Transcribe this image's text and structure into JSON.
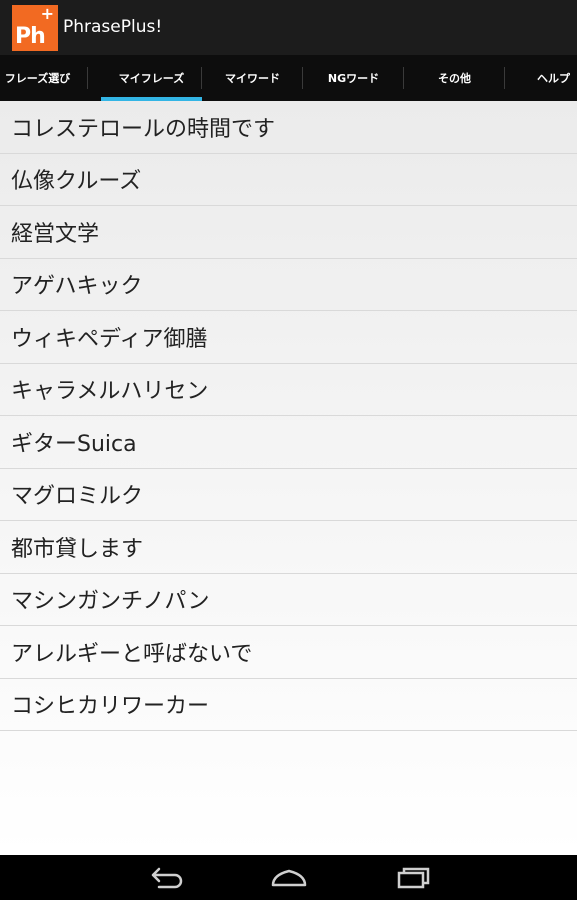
{
  "app": {
    "title": "PhrasePlus!",
    "icon_text": "Ph",
    "icon_plus": "+"
  },
  "colors": {
    "accent": "#33b5e5",
    "icon_bg": "#f26a22"
  },
  "tabs": [
    {
      "label": "フレーズ選び",
      "selected": false
    },
    {
      "label": "マイフレーズ",
      "selected": true
    },
    {
      "label": "マイワード",
      "selected": false
    },
    {
      "label": "NGワード",
      "selected": false
    },
    {
      "label": "その他",
      "selected": false
    },
    {
      "label": "ヘルプ",
      "selected": false
    }
  ],
  "phrases": [
    "コレステロールの時間です",
    "仏像クルーズ",
    "経営文学",
    "アゲハキック",
    "ウィキペディア御膳",
    "キャラメルハリセン",
    "ギターSuica",
    "マグロミルク",
    "都市貸します",
    "マシンガンチノパン",
    "アレルギーと呼ばないで",
    "コシヒカリワーカー"
  ],
  "navbar": {
    "icons": [
      "back-icon",
      "home-icon",
      "recent-apps-icon"
    ]
  }
}
